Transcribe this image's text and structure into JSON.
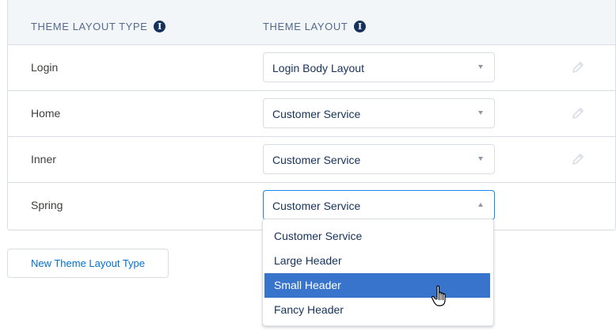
{
  "header": {
    "col_type": "THEME LAYOUT TYPE",
    "col_layout": "THEME LAYOUT",
    "info_glyph": "i"
  },
  "rows": [
    {
      "label": "Login",
      "value": "Login Body Layout"
    },
    {
      "label": "Home",
      "value": "Customer Service"
    },
    {
      "label": "Inner",
      "value": "Customer Service"
    },
    {
      "label": "Spring",
      "value": "Customer Service"
    }
  ],
  "dropdown": {
    "options": [
      "Customer Service",
      "Large Header",
      "Small Header",
      "Fancy Header"
    ],
    "highlighted": "Small Header"
  },
  "new_button": "New Theme Layout Type",
  "colors": {
    "accent": "#0070d2",
    "highlight": "#3874cc",
    "header_bg": "#f3f6f9"
  },
  "icons": {
    "info": "info-circle-icon",
    "edit": "pencil-icon",
    "cursor": "hand-pointer-icon"
  }
}
